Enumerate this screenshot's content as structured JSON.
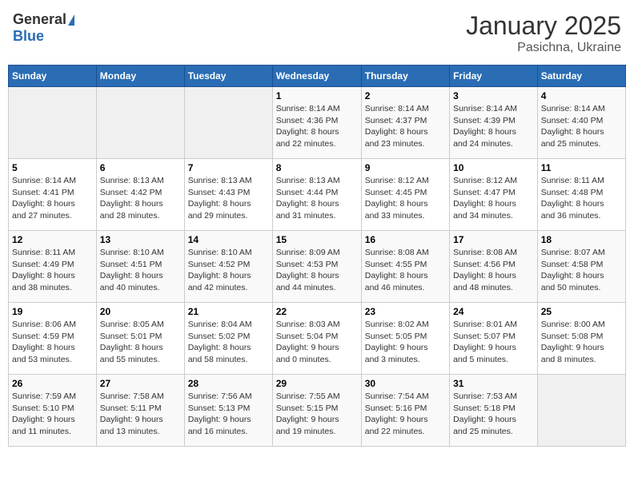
{
  "logo": {
    "general": "General",
    "blue": "Blue"
  },
  "title": "January 2025",
  "subtitle": "Pasichna, Ukraine",
  "days_of_week": [
    "Sunday",
    "Monday",
    "Tuesday",
    "Wednesday",
    "Thursday",
    "Friday",
    "Saturday"
  ],
  "weeks": [
    [
      {
        "day": "",
        "info": ""
      },
      {
        "day": "",
        "info": ""
      },
      {
        "day": "",
        "info": ""
      },
      {
        "day": "1",
        "info": "Sunrise: 8:14 AM\nSunset: 4:36 PM\nDaylight: 8 hours\nand 22 minutes."
      },
      {
        "day": "2",
        "info": "Sunrise: 8:14 AM\nSunset: 4:37 PM\nDaylight: 8 hours\nand 23 minutes."
      },
      {
        "day": "3",
        "info": "Sunrise: 8:14 AM\nSunset: 4:39 PM\nDaylight: 8 hours\nand 24 minutes."
      },
      {
        "day": "4",
        "info": "Sunrise: 8:14 AM\nSunset: 4:40 PM\nDaylight: 8 hours\nand 25 minutes."
      }
    ],
    [
      {
        "day": "5",
        "info": "Sunrise: 8:14 AM\nSunset: 4:41 PM\nDaylight: 8 hours\nand 27 minutes."
      },
      {
        "day": "6",
        "info": "Sunrise: 8:13 AM\nSunset: 4:42 PM\nDaylight: 8 hours\nand 28 minutes."
      },
      {
        "day": "7",
        "info": "Sunrise: 8:13 AM\nSunset: 4:43 PM\nDaylight: 8 hours\nand 29 minutes."
      },
      {
        "day": "8",
        "info": "Sunrise: 8:13 AM\nSunset: 4:44 PM\nDaylight: 8 hours\nand 31 minutes."
      },
      {
        "day": "9",
        "info": "Sunrise: 8:12 AM\nSunset: 4:45 PM\nDaylight: 8 hours\nand 33 minutes."
      },
      {
        "day": "10",
        "info": "Sunrise: 8:12 AM\nSunset: 4:47 PM\nDaylight: 8 hours\nand 34 minutes."
      },
      {
        "day": "11",
        "info": "Sunrise: 8:11 AM\nSunset: 4:48 PM\nDaylight: 8 hours\nand 36 minutes."
      }
    ],
    [
      {
        "day": "12",
        "info": "Sunrise: 8:11 AM\nSunset: 4:49 PM\nDaylight: 8 hours\nand 38 minutes."
      },
      {
        "day": "13",
        "info": "Sunrise: 8:10 AM\nSunset: 4:51 PM\nDaylight: 8 hours\nand 40 minutes."
      },
      {
        "day": "14",
        "info": "Sunrise: 8:10 AM\nSunset: 4:52 PM\nDaylight: 8 hours\nand 42 minutes."
      },
      {
        "day": "15",
        "info": "Sunrise: 8:09 AM\nSunset: 4:53 PM\nDaylight: 8 hours\nand 44 minutes."
      },
      {
        "day": "16",
        "info": "Sunrise: 8:08 AM\nSunset: 4:55 PM\nDaylight: 8 hours\nand 46 minutes."
      },
      {
        "day": "17",
        "info": "Sunrise: 8:08 AM\nSunset: 4:56 PM\nDaylight: 8 hours\nand 48 minutes."
      },
      {
        "day": "18",
        "info": "Sunrise: 8:07 AM\nSunset: 4:58 PM\nDaylight: 8 hours\nand 50 minutes."
      }
    ],
    [
      {
        "day": "19",
        "info": "Sunrise: 8:06 AM\nSunset: 4:59 PM\nDaylight: 8 hours\nand 53 minutes."
      },
      {
        "day": "20",
        "info": "Sunrise: 8:05 AM\nSunset: 5:01 PM\nDaylight: 8 hours\nand 55 minutes."
      },
      {
        "day": "21",
        "info": "Sunrise: 8:04 AM\nSunset: 5:02 PM\nDaylight: 8 hours\nand 58 minutes."
      },
      {
        "day": "22",
        "info": "Sunrise: 8:03 AM\nSunset: 5:04 PM\nDaylight: 9 hours\nand 0 minutes."
      },
      {
        "day": "23",
        "info": "Sunrise: 8:02 AM\nSunset: 5:05 PM\nDaylight: 9 hours\nand 3 minutes."
      },
      {
        "day": "24",
        "info": "Sunrise: 8:01 AM\nSunset: 5:07 PM\nDaylight: 9 hours\nand 5 minutes."
      },
      {
        "day": "25",
        "info": "Sunrise: 8:00 AM\nSunset: 5:08 PM\nDaylight: 9 hours\nand 8 minutes."
      }
    ],
    [
      {
        "day": "26",
        "info": "Sunrise: 7:59 AM\nSunset: 5:10 PM\nDaylight: 9 hours\nand 11 minutes."
      },
      {
        "day": "27",
        "info": "Sunrise: 7:58 AM\nSunset: 5:11 PM\nDaylight: 9 hours\nand 13 minutes."
      },
      {
        "day": "28",
        "info": "Sunrise: 7:56 AM\nSunset: 5:13 PM\nDaylight: 9 hours\nand 16 minutes."
      },
      {
        "day": "29",
        "info": "Sunrise: 7:55 AM\nSunset: 5:15 PM\nDaylight: 9 hours\nand 19 minutes."
      },
      {
        "day": "30",
        "info": "Sunrise: 7:54 AM\nSunset: 5:16 PM\nDaylight: 9 hours\nand 22 minutes."
      },
      {
        "day": "31",
        "info": "Sunrise: 7:53 AM\nSunset: 5:18 PM\nDaylight: 9 hours\nand 25 minutes."
      },
      {
        "day": "",
        "info": ""
      }
    ]
  ]
}
